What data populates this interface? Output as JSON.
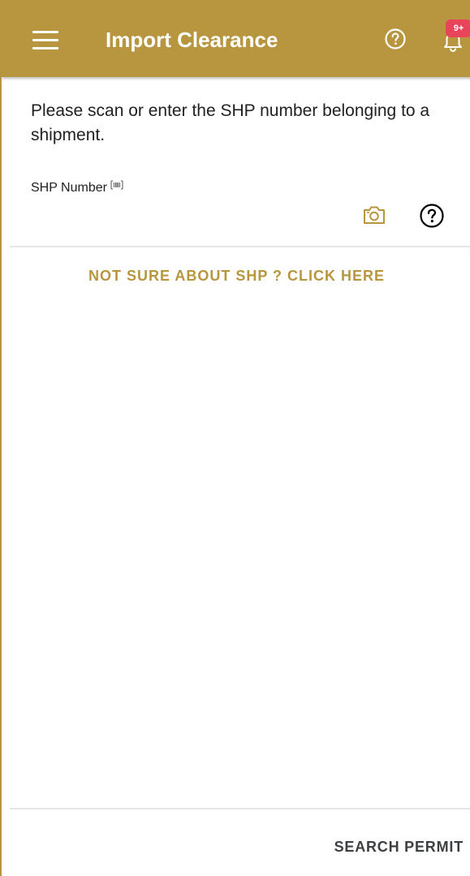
{
  "colors": {
    "primary": "#B8953F",
    "badge": "#E8455A",
    "text": "#202124",
    "divider": "#E6E6E6"
  },
  "appbar": {
    "title": "Import Clearance",
    "menu_icon": "hamburger-menu-icon",
    "help_icon": "help-circle-icon",
    "notification_icon": "bell-icon",
    "notification_badge": "9+"
  },
  "form": {
    "instruction": "Please scan or enter the SHP number belonging to a shipment.",
    "shp_field": {
      "label": "SHP Number",
      "label_icon": "barcode-icon",
      "value": "",
      "placeholder": "",
      "camera_icon": "camera-icon",
      "help_icon": "help-circle-icon"
    },
    "not_sure_link": "NOT SURE ABOUT SHP ? CLICK HERE"
  },
  "footer": {
    "search_button": "SEARCH PERMIT"
  }
}
